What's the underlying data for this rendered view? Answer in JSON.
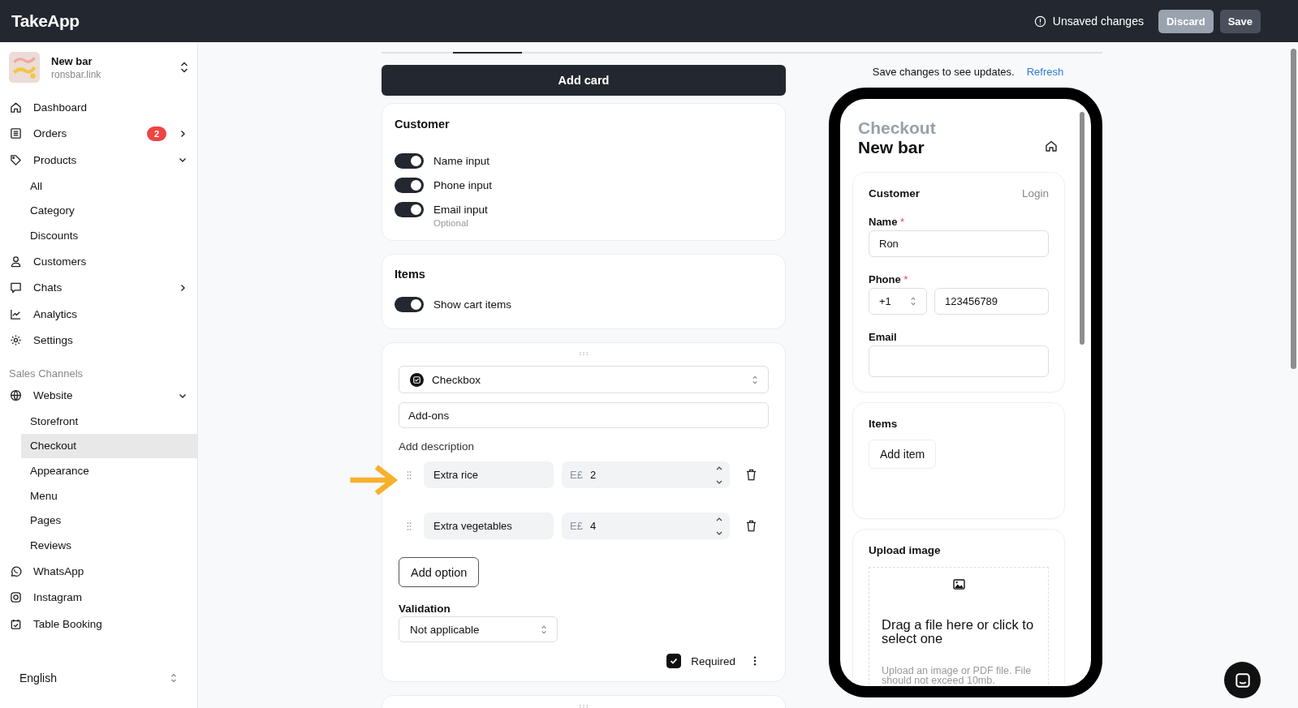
{
  "header": {
    "logo": "TakeApp",
    "status": "Unsaved changes",
    "buttons": [
      {
        "label": "Discard",
        "disabled": true
      },
      {
        "label": "Save",
        "disabled": false
      }
    ]
  },
  "store": {
    "name": "New bar",
    "domain": "ronsbar.link"
  },
  "nav": [
    {
      "label": "Dashboard",
      "selected": false
    },
    {
      "label": "Orders",
      "badge": "2",
      "expanded": false,
      "selected": false
    },
    {
      "label": "Products",
      "expanded": true,
      "selected": false,
      "children": [
        {
          "label": "All",
          "selected": false
        },
        {
          "label": "Category",
          "selected": false
        },
        {
          "label": "Discounts",
          "selected": false
        }
      ]
    },
    {
      "label": "Customers",
      "selected": false
    },
    {
      "label": "Chats",
      "expanded": false,
      "selected": false
    },
    {
      "label": "Analytics",
      "selected": false
    },
    {
      "label": "Settings",
      "selected": false
    }
  ],
  "sales_channels": {
    "title": "Sales Channels",
    "items": [
      {
        "label": "Website",
        "expanded": true,
        "selected": false,
        "children": [
          {
            "label": "Storefront",
            "selected": false
          },
          {
            "label": "Checkout",
            "selected": true
          },
          {
            "label": "Appearance",
            "selected": false
          },
          {
            "label": "Menu",
            "selected": false
          },
          {
            "label": "Pages",
            "selected": false
          },
          {
            "label": "Reviews",
            "selected": false
          }
        ]
      },
      {
        "label": "WhatsApp",
        "selected": false
      },
      {
        "label": "Instagram",
        "selected": false
      },
      {
        "label": "Table Booking",
        "selected": false
      }
    ]
  },
  "language": "English",
  "editor": {
    "add_card": "Add card",
    "customer_card": {
      "title": "Customer",
      "toggles": [
        {
          "label": "Name input",
          "on": true
        },
        {
          "label": "Phone input",
          "on": true
        },
        {
          "label": "Email input",
          "on": true,
          "hint": "Optional"
        }
      ]
    },
    "items_card": {
      "title": "Items",
      "toggles": [
        {
          "label": "Show cart items",
          "on": true
        }
      ]
    },
    "field_card": {
      "type": "Checkbox",
      "title": "Add-ons",
      "add_description": "Add description",
      "options": [
        {
          "name": "Extra rice",
          "currency": "E£",
          "price": "2"
        },
        {
          "name": "Extra vegetables",
          "currency": "E£",
          "price": "4"
        }
      ],
      "add_option": "Add option",
      "validation_label": "Validation",
      "validation": "Not applicable",
      "required": {
        "label": "Required",
        "checked": true
      }
    }
  },
  "preview": {
    "note": "Save changes to see updates.",
    "refresh": "Refresh",
    "heading": "Checkout",
    "store_name": "New bar",
    "customer": {
      "title": "Customer",
      "login": "Login",
      "name": {
        "label": "Name",
        "mark": "*",
        "value": "Ron"
      },
      "phone": {
        "label": "Phone",
        "mark": "*",
        "code": "+1",
        "value": "123456789"
      },
      "email": {
        "label": "Email"
      }
    },
    "items": {
      "title": "Items",
      "add_item": "Add item"
    },
    "upload": {
      "title": "Upload image",
      "drag": "Drag a file here or click to select one",
      "hint": "Upload an image or PDF file. File should not exceed 10mb."
    }
  }
}
